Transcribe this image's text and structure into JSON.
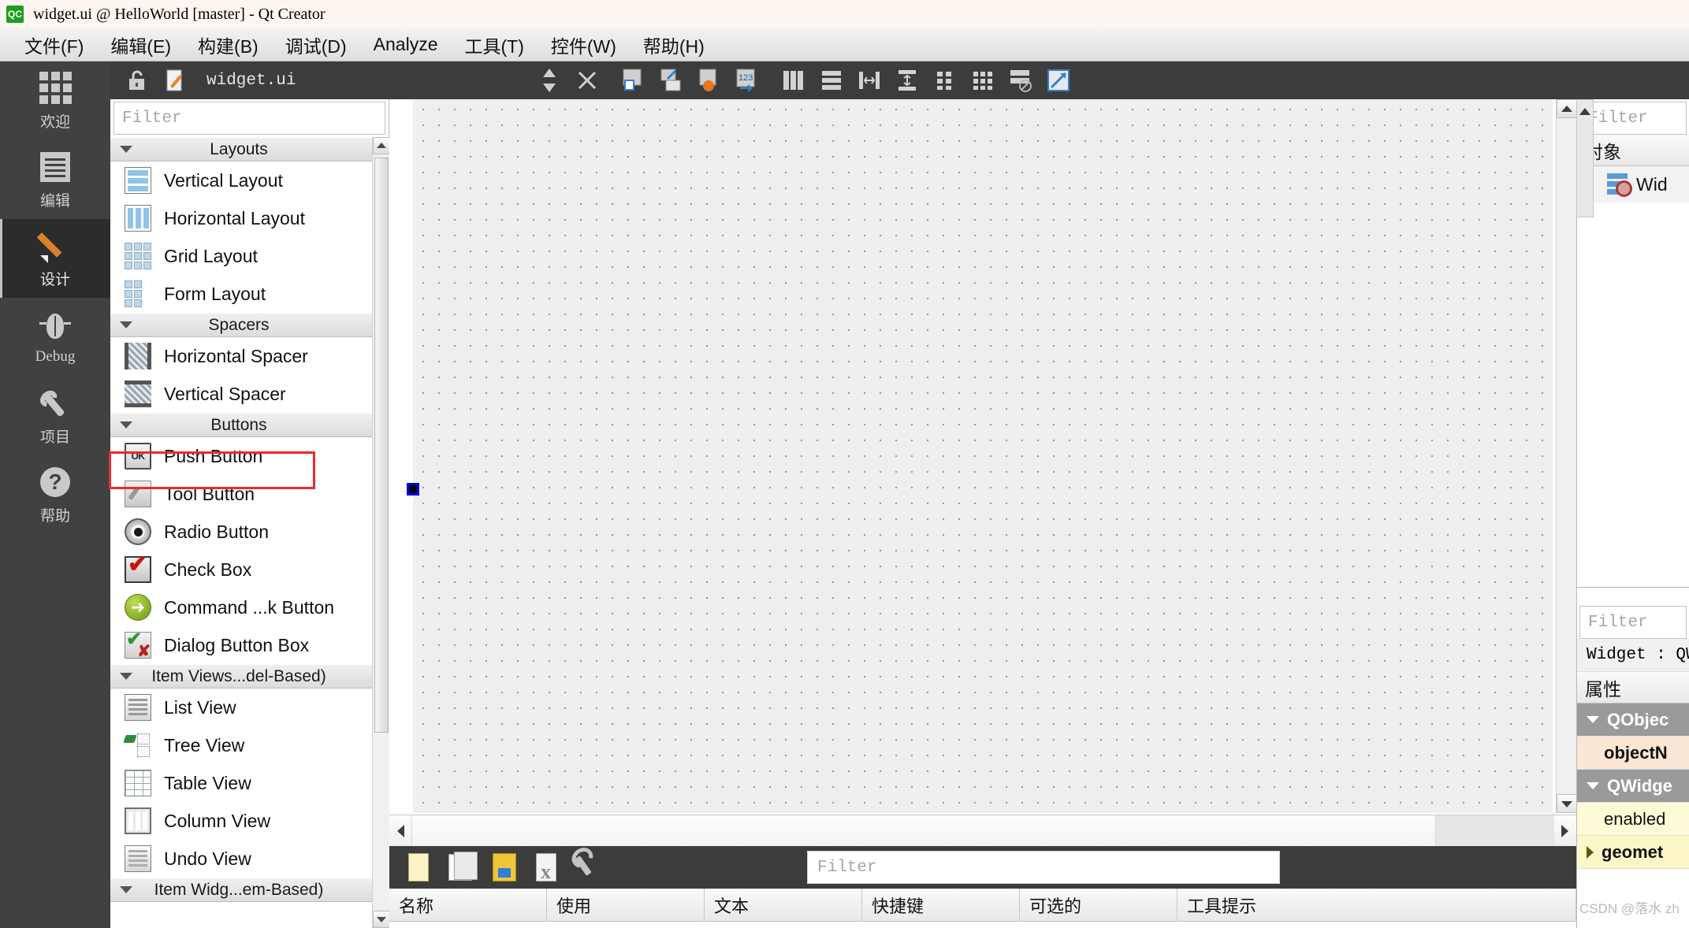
{
  "titlebar": {
    "logo": "QC",
    "title": "widget.ui @ HelloWorld [master] - Qt Creator"
  },
  "menubar": {
    "items": [
      {
        "label": "文件(F)",
        "mnemonic": "F"
      },
      {
        "label": "编辑(E)",
        "mnemonic": "E"
      },
      {
        "label": "构建(B)",
        "mnemonic": "B"
      },
      {
        "label": "调试(D)",
        "mnemonic": "D"
      },
      {
        "label": "Analyze",
        "mnemonic": "A"
      },
      {
        "label": "工具(T)",
        "mnemonic": "T"
      },
      {
        "label": "控件(W)",
        "mnemonic": "W"
      },
      {
        "label": "帮助(H)",
        "mnemonic": "H"
      }
    ]
  },
  "modebar": {
    "items": [
      {
        "label": "欢迎",
        "icon": "grid-icon",
        "active": false
      },
      {
        "label": "编辑",
        "icon": "document-lines-icon",
        "active": false
      },
      {
        "label": "设计",
        "icon": "pencil-icon",
        "active": true
      },
      {
        "label": "Debug",
        "icon": "bug-icon",
        "active": false
      },
      {
        "label": "项目",
        "icon": "wrench-icon",
        "active": false
      },
      {
        "label": "帮助",
        "icon": "question-mark-icon",
        "active": false
      }
    ]
  },
  "designer_toolbar": {
    "file_label": "widget.ui",
    "icons": [
      "lock-open-icon",
      "pencil-file-icon",
      "updown-arrows-icon",
      "close-x-icon",
      "edit-widgets-icon",
      "edit-signals-slots-icon",
      "edit-buddies-icon",
      "edit-tab-order-icon",
      "layout-horizontal-icon",
      "layout-vertical-icon",
      "layout-splitter-h-icon",
      "layout-splitter-v-icon",
      "layout-form-icon",
      "layout-grid-icon",
      "break-layout-icon",
      "adjust-size-icon"
    ]
  },
  "widgetbox": {
    "filter_placeholder": "Filter",
    "categories": [
      {
        "name": "Layouts",
        "items": [
          {
            "label": "Vertical Layout",
            "icon": "vertical-layout-icon"
          },
          {
            "label": "Horizontal Layout",
            "icon": "horizontal-layout-icon"
          },
          {
            "label": "Grid Layout",
            "icon": "grid-layout-icon"
          },
          {
            "label": "Form Layout",
            "icon": "form-layout-icon"
          }
        ]
      },
      {
        "name": "Spacers",
        "items": [
          {
            "label": "Horizontal Spacer",
            "icon": "horizontal-spacer-icon"
          },
          {
            "label": "Vertical Spacer",
            "icon": "vertical-spacer-icon"
          }
        ]
      },
      {
        "name": "Buttons",
        "items": [
          {
            "label": "Push Button",
            "icon": "push-button-icon",
            "highlighted": true
          },
          {
            "label": "Tool Button",
            "icon": "tool-button-icon"
          },
          {
            "label": "Radio Button",
            "icon": "radio-button-icon"
          },
          {
            "label": "Check Box",
            "icon": "check-box-icon"
          },
          {
            "label": "Command ...k Button",
            "icon": "command-link-icon"
          },
          {
            "label": "Dialog Button Box",
            "icon": "dialog-button-box-icon"
          }
        ]
      },
      {
        "name": "Item Views...del-Based)",
        "items": [
          {
            "label": "List View",
            "icon": "list-view-icon"
          },
          {
            "label": "Tree View",
            "icon": "tree-view-icon"
          },
          {
            "label": "Table View",
            "icon": "table-view-icon"
          },
          {
            "label": "Column View",
            "icon": "column-view-icon"
          },
          {
            "label": "Undo View",
            "icon": "undo-view-icon"
          }
        ]
      },
      {
        "name": "Item Widg...em-Based)",
        "items": []
      }
    ]
  },
  "object_inspector": {
    "filter_placeholder": "Filter",
    "header": "对象",
    "rows": [
      {
        "name": "Wid",
        "icon": "widget-disabled-icon"
      }
    ]
  },
  "property_editor": {
    "filter_placeholder": "Filter",
    "target": "Widget : QW",
    "header": "属性",
    "rows": [
      {
        "label": "QObjec",
        "kind": "group"
      },
      {
        "label": "objectN",
        "kind": "objname"
      },
      {
        "label": "QWidge",
        "kind": "group"
      },
      {
        "label": "enabled",
        "kind": "enabled"
      },
      {
        "label": "geomet",
        "kind": "geom"
      }
    ]
  },
  "action_editor": {
    "filter_placeholder": "Filter",
    "toolbar_icons": [
      "new-action-icon",
      "copy-icon",
      "save-icon",
      "delete-x-icon",
      "configure-wrench-icon"
    ],
    "columns": [
      "名称",
      "使用",
      "文本",
      "快捷键",
      "可选的",
      "工具提示"
    ],
    "rows": []
  },
  "watermark": "CSDN @落水 zh",
  "colors": {
    "highlight_red": "#ec2b2b",
    "accent_orange": "#d9822b",
    "mode_bar_bg": "#414141",
    "active_mode_bg": "#2c2c2c",
    "toolbar_bg": "#3c3c3c",
    "canvas_bg": "#efefef",
    "selection_blue": "#0000ee"
  }
}
